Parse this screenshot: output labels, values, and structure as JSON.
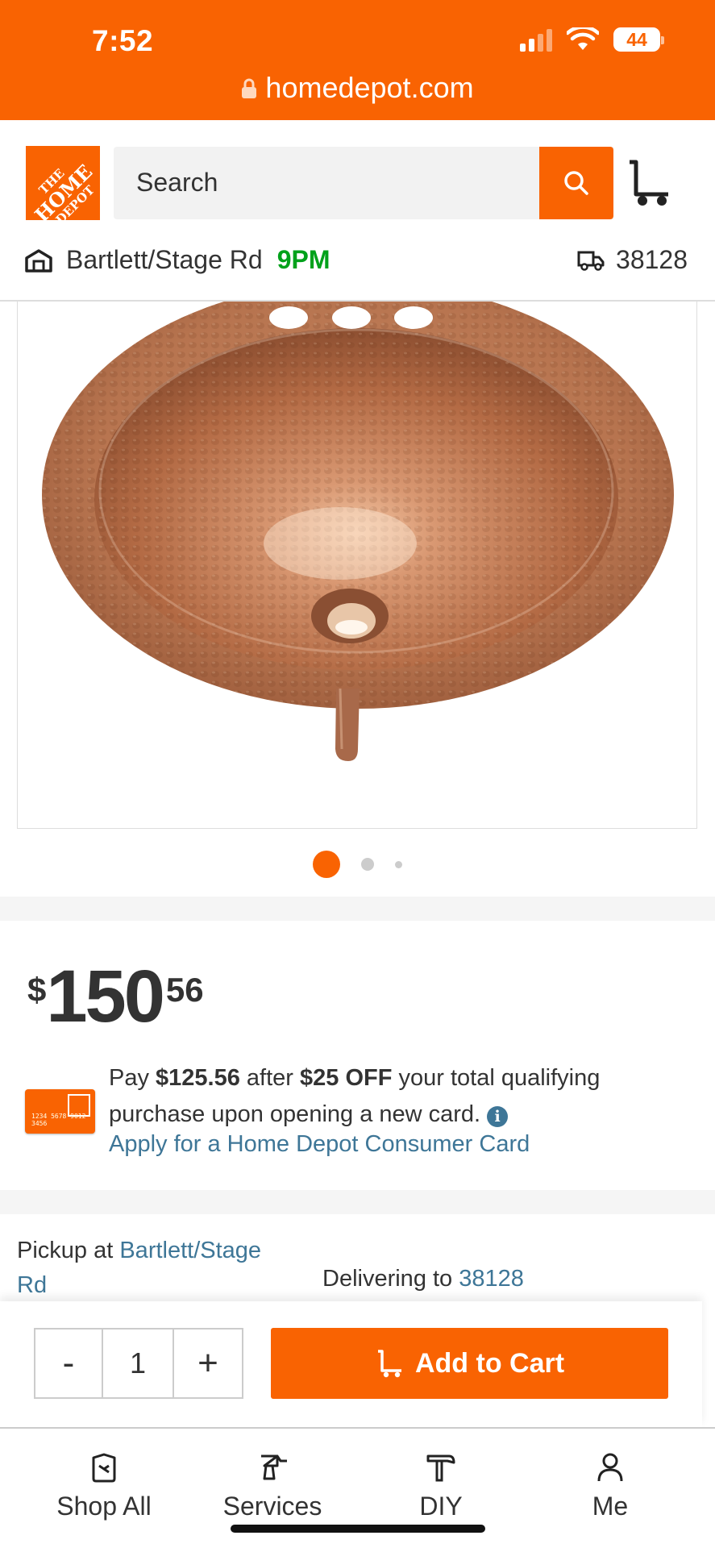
{
  "status_bar": {
    "time": "7:52",
    "battery": "44"
  },
  "browser": {
    "url": "homedepot.com"
  },
  "header": {
    "logo_lines": [
      "THE",
      "HOME",
      "DEPOT"
    ],
    "search_placeholder": "Search",
    "store_name": "Bartlett/Stage Rd",
    "store_hours": "9PM",
    "delivery_zip": "38128"
  },
  "product": {
    "image_icon": "copper-sink-image",
    "image_count": 3,
    "active_image": 1
  },
  "price": {
    "currency": "$",
    "dollars": "150",
    "cents": "56"
  },
  "promo": {
    "pay_prefix": "Pay ",
    "pay_amount": "$125.56",
    "after_text": " after ",
    "discount": "$25 OFF",
    "rest_text": " your total qualifying purchase upon opening a new card.",
    "info_symbol": "i",
    "apply_link": "Apply for a Home Depot Consumer Card",
    "card_number": "1234 5678 9012 3456"
  },
  "fulfillment": {
    "pickup_prefix": "Pickup at ",
    "pickup_store": "Bartlett/Stage Rd",
    "deliver_prefix": "Delivering to ",
    "deliver_zip": "38128"
  },
  "cart": {
    "minus": "-",
    "quantity": "1",
    "plus": "+",
    "add_label": "Add to Cart"
  },
  "bottom_nav": [
    {
      "label": "Shop All",
      "icon": "tag-icon"
    },
    {
      "label": "Services",
      "icon": "drill-icon"
    },
    {
      "label": "DIY",
      "icon": "hammer-icon"
    },
    {
      "label": "Me",
      "icon": "user-icon"
    }
  ],
  "colors": {
    "brand_orange": "#f96302",
    "link_blue": "#3e7697",
    "open_green": "#00a11b"
  }
}
